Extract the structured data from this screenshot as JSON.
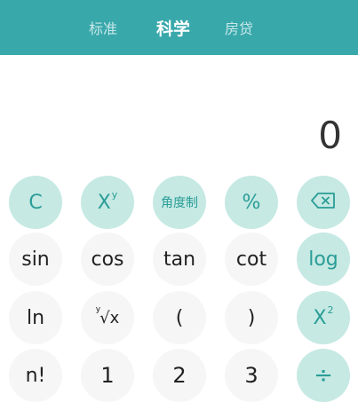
{
  "tabs": [
    {
      "label": "标准"
    },
    {
      "label": "科学"
    },
    {
      "label": "房贷"
    }
  ],
  "display": {
    "value": "0"
  },
  "keys": {
    "clear": "C",
    "power_base": "X",
    "power_exp": "y",
    "angle_mode": "角度制",
    "percent": "%",
    "sin": "sin",
    "cos": "cos",
    "tan": "tan",
    "cot": "cot",
    "log": "log",
    "ln": "ln",
    "root_index": "y",
    "root_body": "√x",
    "open_paren": "(",
    "close_paren": ")",
    "square_base": "X",
    "square_exp": "2",
    "factorial": "n!",
    "one": "1",
    "two": "2",
    "three": "3",
    "divide": "÷"
  },
  "colors": {
    "header": "#38a8ab",
    "accent_key": "#c6e9e3",
    "accent_text": "#2a9d97",
    "plain_key": "#f6f6f6"
  },
  "icons": {
    "backspace": "backspace-icon"
  }
}
